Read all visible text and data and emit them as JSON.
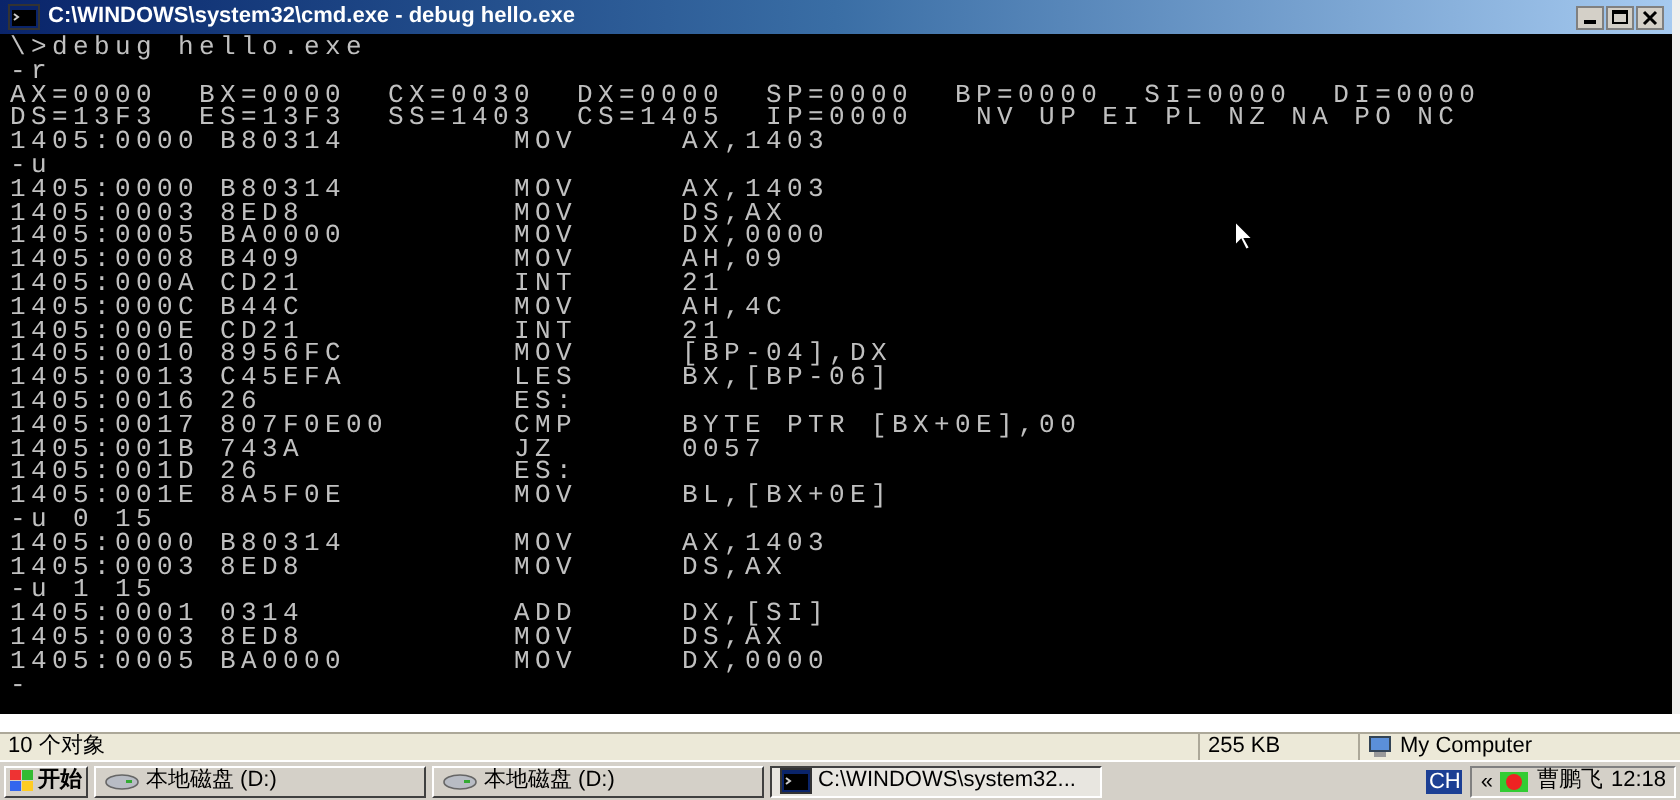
{
  "window": {
    "title": "C:\\WINDOWS\\system32\\cmd.exe - debug hello.exe"
  },
  "console": {
    "lines": [
      "\\>debug hello.exe",
      "-r",
      "AX=0000  BX=0000  CX=0030  DX=0000  SP=0000  BP=0000  SI=0000  DI=0000",
      "DS=13F3  ES=13F3  SS=1403  CS=1405  IP=0000   NV UP EI PL NZ NA PO NC",
      "1405:0000 B80314        MOV     AX,1403",
      "-u",
      "1405:0000 B80314        MOV     AX,1403",
      "1405:0003 8ED8          MOV     DS,AX",
      "1405:0005 BA0000        MOV     DX,0000",
      "1405:0008 B409          MOV     AH,09",
      "1405:000A CD21          INT     21",
      "1405:000C B44C          MOV     AH,4C",
      "1405:000E CD21          INT     21",
      "1405:0010 8956FC        MOV     [BP-04],DX",
      "1405:0013 C45EFA        LES     BX,[BP-06]",
      "1405:0016 26            ES:",
      "1405:0017 807F0E00      CMP     BYTE PTR [BX+0E],00",
      "1405:001B 743A          JZ      0057",
      "1405:001D 26            ES:",
      "1405:001E 8A5F0E        MOV     BL,[BX+0E]",
      "-u 0 15",
      "1405:0000 B80314        MOV     AX,1403",
      "1405:0003 8ED8          MOV     DS,AX",
      "-u 1 15",
      "1405:0001 0314          ADD     DX,[SI]",
      "1405:0003 8ED8          MOV     DS,AX",
      "1405:0005 BA0000        MOV     DX,0000",
      "-"
    ]
  },
  "status_bar": {
    "objects": "10 个对象",
    "size": "255 KB",
    "location": "My Computer"
  },
  "taskbar": {
    "start": "开始",
    "tasks": [
      {
        "kind": "drive",
        "label": "本地磁盘 (D:)",
        "selected": false
      },
      {
        "kind": "drive",
        "label": "本地磁盘 (D:)",
        "selected": false
      },
      {
        "kind": "console",
        "label": "C:\\WINDOWS\\system32...",
        "selected": true
      }
    ],
    "language": "CH",
    "expand": "«",
    "user": "曹鹏飞",
    "clock": "12:18"
  }
}
